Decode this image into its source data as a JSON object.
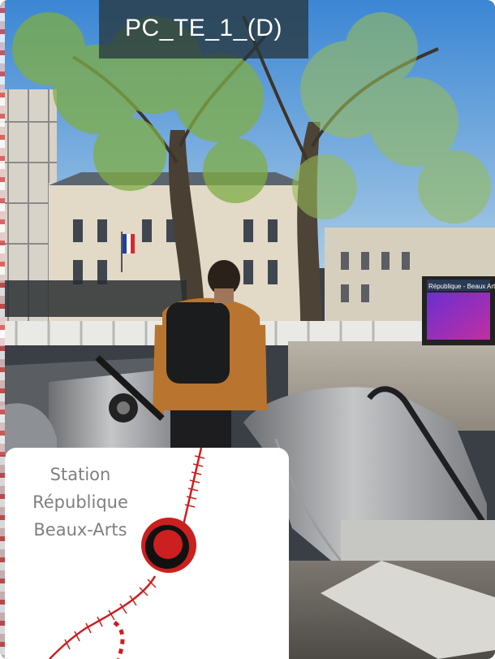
{
  "title": "PC_TE_1_(D)",
  "station": {
    "line1": "Station",
    "line2": "République",
    "line3": "Beaux-Arts"
  },
  "sign": {
    "text": "République - Beaux Arts"
  },
  "colors": {
    "accent": "#cc1f1f",
    "title_bg": "#2b3a40",
    "station_text": "#7f7f7f"
  }
}
